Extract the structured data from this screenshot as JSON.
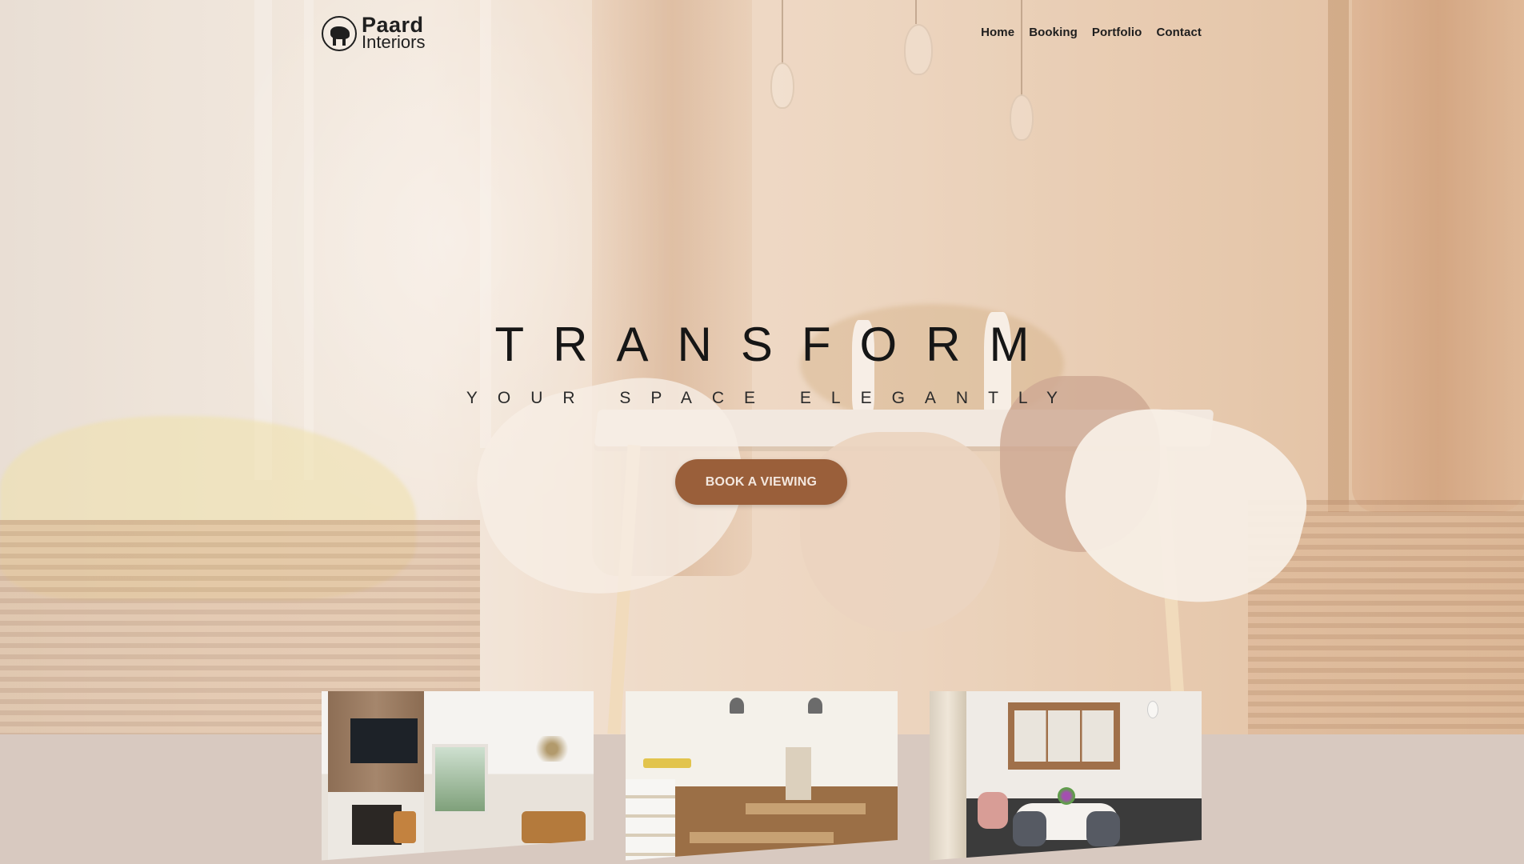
{
  "brand": {
    "name": "Paard",
    "sub": "Interiors"
  },
  "nav": {
    "items": [
      "Home",
      "Booking",
      "Portfolio",
      "Contact"
    ]
  },
  "hero": {
    "title": "TRANSFORM",
    "subtitle": "YOUR SPACE ELEGANTLY",
    "cta_label": "BOOK A VIEWING"
  },
  "colors": {
    "cta_bg": "#9a5f3a",
    "page_bg": "#d8c9c0",
    "text_dark": "#161616"
  },
  "icons": {
    "logo": "horse-logo-icon"
  }
}
